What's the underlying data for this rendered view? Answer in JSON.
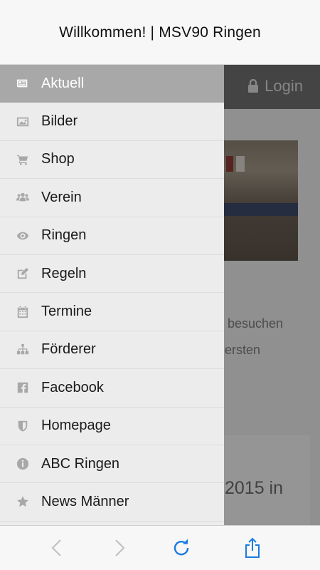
{
  "window": {
    "title": "Willkommen! | MSV90 Ringen"
  },
  "background_page": {
    "login_label": "Login",
    "text_line_1": "besuchen",
    "text_line_2": "ersten",
    "year_text": "2015 in"
  },
  "menu": {
    "items": [
      {
        "label": "Aktuell",
        "icon": "newspaper-icon",
        "active": true
      },
      {
        "label": "Bilder",
        "icon": "image-icon"
      },
      {
        "label": "Shop",
        "icon": "cart-icon"
      },
      {
        "label": "Verein",
        "icon": "users-icon"
      },
      {
        "label": "Ringen",
        "icon": "eye-icon"
      },
      {
        "label": "Regeln",
        "icon": "edit-icon"
      },
      {
        "label": "Termine",
        "icon": "calendar-icon"
      },
      {
        "label": "Förderer",
        "icon": "sitemap-icon"
      },
      {
        "label": "Facebook",
        "icon": "facebook-icon"
      },
      {
        "label": "Homepage",
        "icon": "shield-icon"
      },
      {
        "label": "ABC Ringen",
        "icon": "info-icon"
      },
      {
        "label": "News Männer",
        "icon": "star-icon"
      }
    ]
  },
  "toolbar": {
    "back": "back-arrow-icon",
    "forward": "forward-arrow-icon",
    "reload": "reload-icon",
    "share": "share-icon"
  },
  "colors": {
    "accent_blue": "#1a7be0",
    "active_item": "#a8a8a8",
    "drawer_bg": "#ececec",
    "icon_gray": "#a8a8a8"
  }
}
